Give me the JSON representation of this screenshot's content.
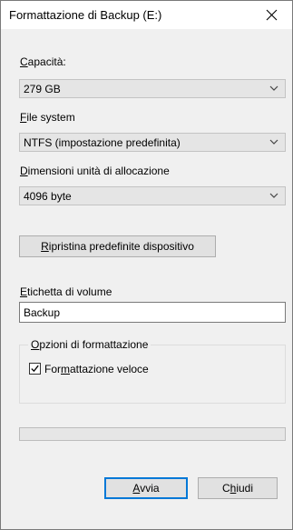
{
  "window": {
    "title": "Formattazione di Backup (E:)"
  },
  "capacity": {
    "label_mnemonic": "C",
    "label_rest": "apacità:",
    "value": "279 GB"
  },
  "filesystem": {
    "label_mnemonic": "F",
    "label_rest": "ile system",
    "value": "NTFS (impostazione predefinita)"
  },
  "allocation": {
    "label_mnemonic": "D",
    "label_rest": "imensioni unità di allocazione",
    "value": "4096 byte"
  },
  "restore_button": {
    "label_mnemonic": "R",
    "label_rest": "ipristina predefinite dispositivo"
  },
  "volume_label": {
    "label_mnemonic": "E",
    "label_rest": "tichetta di volume",
    "value": "Backup"
  },
  "format_options": {
    "title_mnemonic": "O",
    "title_rest": "pzioni di formattazione",
    "quick_format": {
      "label_before": "For",
      "label_mnemonic": "m",
      "label_after": "attazione veloce",
      "checked": true
    }
  },
  "progress": {
    "percent": 0
  },
  "buttons": {
    "start_mnemonic": "A",
    "start_rest": "vvia",
    "close_before": "C",
    "close_mnemonic": "h",
    "close_after": "iudi"
  },
  "icons": {
    "close": "close-icon",
    "chevron": "chevron-down-icon",
    "check": "checkmark-icon"
  },
  "colors": {
    "accent": "#0078d7",
    "dialog_background": "#f0f0f0",
    "combo_background": "#e5e5e5"
  }
}
